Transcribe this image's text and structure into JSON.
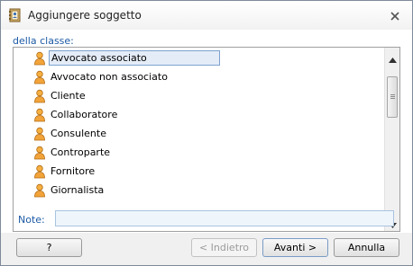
{
  "window": {
    "title": "Aggiungere soggetto"
  },
  "class_label": "della classe:",
  "list_items": [
    "Avvocato associato",
    "Avvocato non associato",
    "Cliente",
    "Collaboratore",
    "Consulente",
    "Controparte",
    "Fornitore",
    "Giornalista"
  ],
  "selected_item": "Avvocato associato",
  "note": {
    "label": "Note:",
    "value": ""
  },
  "buttons": {
    "help": "?",
    "back": "< Indietro",
    "next": "Avanti >",
    "cancel": "Annulla"
  },
  "colors": {
    "label_blue": "#1c5aa6",
    "selection": "#e4ecf7",
    "person_icon": "#f2a43a"
  },
  "icons": {
    "title": "address-book-icon",
    "item": "person-icon",
    "close": "close-icon"
  }
}
